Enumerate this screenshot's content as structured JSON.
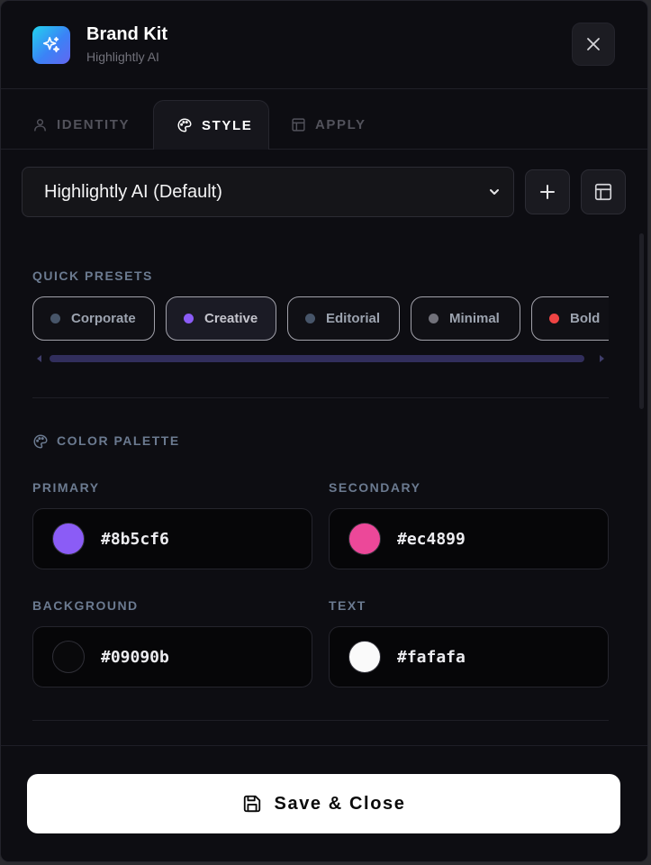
{
  "header": {
    "title": "Brand Kit",
    "subtitle": "Highlightly AI",
    "logo_icon": "sparkles-icon",
    "close_icon": "close-icon"
  },
  "tabs": [
    {
      "label": "IDENTITY",
      "icon": "user-icon",
      "active": false
    },
    {
      "label": "STYLE",
      "icon": "palette-icon",
      "active": true
    },
    {
      "label": "APPLY",
      "icon": "layout-icon",
      "active": false
    }
  ],
  "kit_select": {
    "selected": "Highlightly AI (Default)",
    "add_icon": "plus-icon",
    "layout_icon": "layout-icon"
  },
  "presets": {
    "label": "QUICK PRESETS",
    "items": [
      {
        "label": "Corporate",
        "dot_color": "#475569",
        "active": false
      },
      {
        "label": "Creative",
        "dot_color": "#8b5cf6",
        "active": true
      },
      {
        "label": "Editorial",
        "dot_color": "#475569",
        "active": false
      },
      {
        "label": "Minimal",
        "dot_color": "#71717a",
        "active": false
      },
      {
        "label": "Bold",
        "dot_color": "#ef4444",
        "active": false
      }
    ]
  },
  "palette": {
    "label": "COLOR PALETTE",
    "icon": "palette-icon",
    "primary": {
      "label": "PRIMARY",
      "value": "#8b5cf6"
    },
    "secondary": {
      "label": "SECONDARY",
      "value": "#ec4899"
    },
    "background": {
      "label": "BACKGROUND",
      "value": "#09090b"
    },
    "text": {
      "label": "TEXT",
      "value": "#fafafa"
    }
  },
  "footer": {
    "save_label": "Save & Close",
    "save_icon": "save-icon"
  }
}
